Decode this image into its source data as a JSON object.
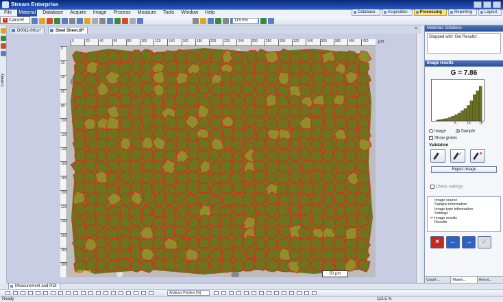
{
  "app": {
    "title": "Stream Enterprise"
  },
  "menu": {
    "items": [
      "File",
      "Material",
      "Database",
      "Acquire",
      "Image",
      "Process",
      "Measure",
      "Tools",
      "Window",
      "Help"
    ],
    "active_index": 1,
    "popup_label": "Cancel"
  },
  "tabs": [
    "Database",
    "Acquisition",
    "Processing",
    "Reporting",
    "Layout"
  ],
  "active_tab": 2,
  "toolbar": {
    "zoom": "115.5%"
  },
  "documents": [
    {
      "label": "D0011-001s*"
    },
    {
      "label": "Steel Sheet.tif*"
    }
  ],
  "left_panel": {
    "label": "Gallery"
  },
  "ruler": {
    "h_ticks": [
      "0",
      "20",
      "40",
      "60",
      "80",
      "100",
      "120",
      "140",
      "160",
      "180",
      "200",
      "220",
      "240",
      "260",
      "280",
      "300",
      "320",
      "340",
      "360",
      "380",
      "400",
      "420"
    ],
    "v_ticks": [
      "0",
      "20",
      "40",
      "60",
      "80",
      "100",
      "120",
      "140",
      "160",
      "180",
      "200",
      "220",
      "240",
      "260",
      "280",
      "300"
    ],
    "unit": "µm"
  },
  "image": {
    "scalebar": "50 µm",
    "logo": "OLYMPUS"
  },
  "colors": {
    "grain_fill": "#6e741e",
    "grain_boundary": "#e3241c",
    "background_steel": "#bdbdbd",
    "accent": "#ffe27a"
  },
  "right_panel": {
    "header": "Materials Solutions",
    "message": "Stopped with 'Get Results'.",
    "results_title": "Image results",
    "g_value": "G = 7.86",
    "histogram": {
      "x_ticks": [
        "5",
        "10",
        "15"
      ],
      "values": [
        0.02,
        0.03,
        0.05,
        0.06,
        0.09,
        0.12,
        0.16,
        0.2,
        0.26,
        0.32,
        0.4,
        0.52,
        0.68,
        0.78,
        0.9
      ]
    },
    "radio_image": "Image",
    "radio_sample": "Sample",
    "show_grains": "Show grains",
    "validation": "Validation",
    "reject_button": "Reject Image",
    "check_settings": "Check settings",
    "steps": [
      "Image source",
      "Sample information",
      "Image type information",
      "Settings",
      "Image results",
      "Results"
    ],
    "current_step": 4,
    "bottom_tabs": [
      "Count ...",
      "Materi...",
      "Annot..."
    ]
  },
  "bottom": {
    "tab": "Measurement and ROI",
    "select": "Arbitrary Polyline [%]"
  },
  "status": {
    "left": "Ready",
    "zoom": "115.5 %"
  }
}
